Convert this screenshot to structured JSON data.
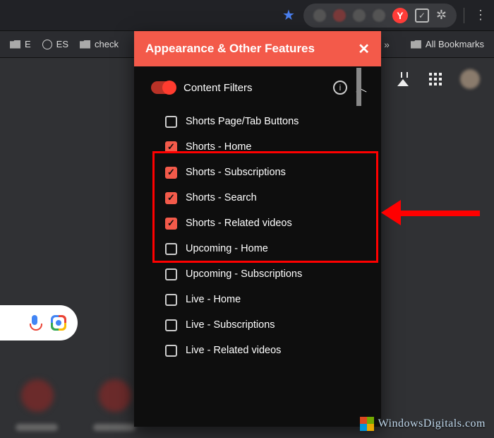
{
  "chrome": {
    "ext_badge": "Y"
  },
  "bookmarks": {
    "items": [
      {
        "label": "E",
        "icon": "folder"
      },
      {
        "label": "ES",
        "icon": "globe"
      },
      {
        "label": "check",
        "icon": "folder"
      }
    ],
    "all_bookmarks_label": "All Bookmarks"
  },
  "popup": {
    "title": "Appearance & Other Features",
    "section": {
      "label": "Content Filters",
      "toggled": true
    },
    "filters": [
      {
        "label": "Shorts Page/Tab Buttons",
        "checked": false
      },
      {
        "label": "Shorts - Home",
        "checked": true
      },
      {
        "label": "Shorts - Subscriptions",
        "checked": true
      },
      {
        "label": "Shorts - Search",
        "checked": true
      },
      {
        "label": "Shorts - Related videos",
        "checked": true
      },
      {
        "label": "Upcoming - Home",
        "checked": false
      },
      {
        "label": "Upcoming - Subscriptions",
        "checked": false
      },
      {
        "label": "Live - Home",
        "checked": false
      },
      {
        "label": "Live - Subscriptions",
        "checked": false
      },
      {
        "label": "Live - Related videos",
        "checked": false
      }
    ]
  },
  "watermark": {
    "text": "WindowsDigitals.com"
  }
}
